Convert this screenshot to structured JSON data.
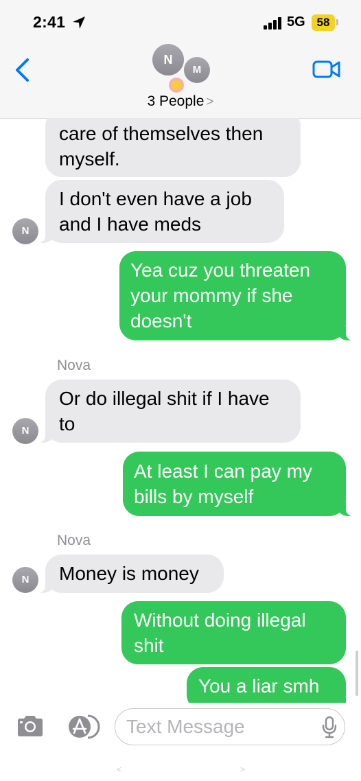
{
  "status": {
    "time": "2:41",
    "network": "5G",
    "battery": "58"
  },
  "header": {
    "avatars": [
      {
        "initial": "N"
      },
      {
        "initial": "M"
      }
    ],
    "group_name": "3 People",
    "chevron": ">"
  },
  "messages": [
    {
      "direction": "incoming",
      "lines": [
        "care of themselves then",
        "myself."
      ]
    },
    {
      "direction": "incoming",
      "avatar": "N",
      "lines": [
        "I don't even have a job",
        "and I have meds"
      ]
    },
    {
      "direction": "outgoing",
      "lines": [
        "Yea cuz you threaten",
        "your mommy if she",
        "doesn't"
      ]
    },
    {
      "direction": "incoming",
      "sender": "Nova",
      "avatar": "N",
      "lines": [
        "Or do illegal shit if I have",
        "to"
      ]
    },
    {
      "direction": "outgoing",
      "lines": [
        "At least I can pay my",
        "bills by myself"
      ]
    },
    {
      "direction": "incoming",
      "sender": "Nova",
      "avatar": "N",
      "lines": [
        "Money is money"
      ]
    },
    {
      "direction": "outgoing",
      "lines": [
        "Without doing illegal",
        "shit"
      ]
    },
    {
      "direction": "outgoing",
      "lines": [
        "You a liar smh"
      ]
    }
  ],
  "input": {
    "placeholder": "Text Message"
  },
  "home_hint": {
    "left": "<",
    "right": ">"
  },
  "colors": {
    "outgoing": "#34c759",
    "incoming": "#e9e9eb",
    "accent": "#007aff",
    "battery": "#f5d21f"
  },
  "icons": [
    "location-arrow-icon",
    "signal-icon",
    "back-chevron-icon",
    "video-camera-icon",
    "emoji-icon",
    "camera-icon",
    "app-store-icon",
    "microphone-icon"
  ]
}
